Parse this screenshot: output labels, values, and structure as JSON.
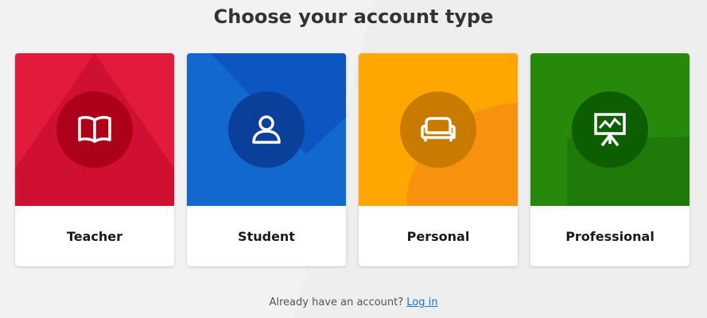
{
  "header": {
    "title": "Choose your account type"
  },
  "cards": [
    {
      "label": "Teacher",
      "icon": "book-icon",
      "color": "#e21b3c",
      "circle": "#ad0019"
    },
    {
      "label": "Student",
      "icon": "user-icon",
      "color": "#1368ce",
      "circle": "#0a3f9a"
    },
    {
      "label": "Personal",
      "icon": "sofa-icon",
      "color": "#ffa602",
      "circle": "#c97a00"
    },
    {
      "label": "Professional",
      "icon": "presentation-board-icon",
      "color": "#26890c",
      "circle": "#0d5e00"
    }
  ],
  "footer": {
    "text": "Already have an account?",
    "login_link": "Log in"
  }
}
